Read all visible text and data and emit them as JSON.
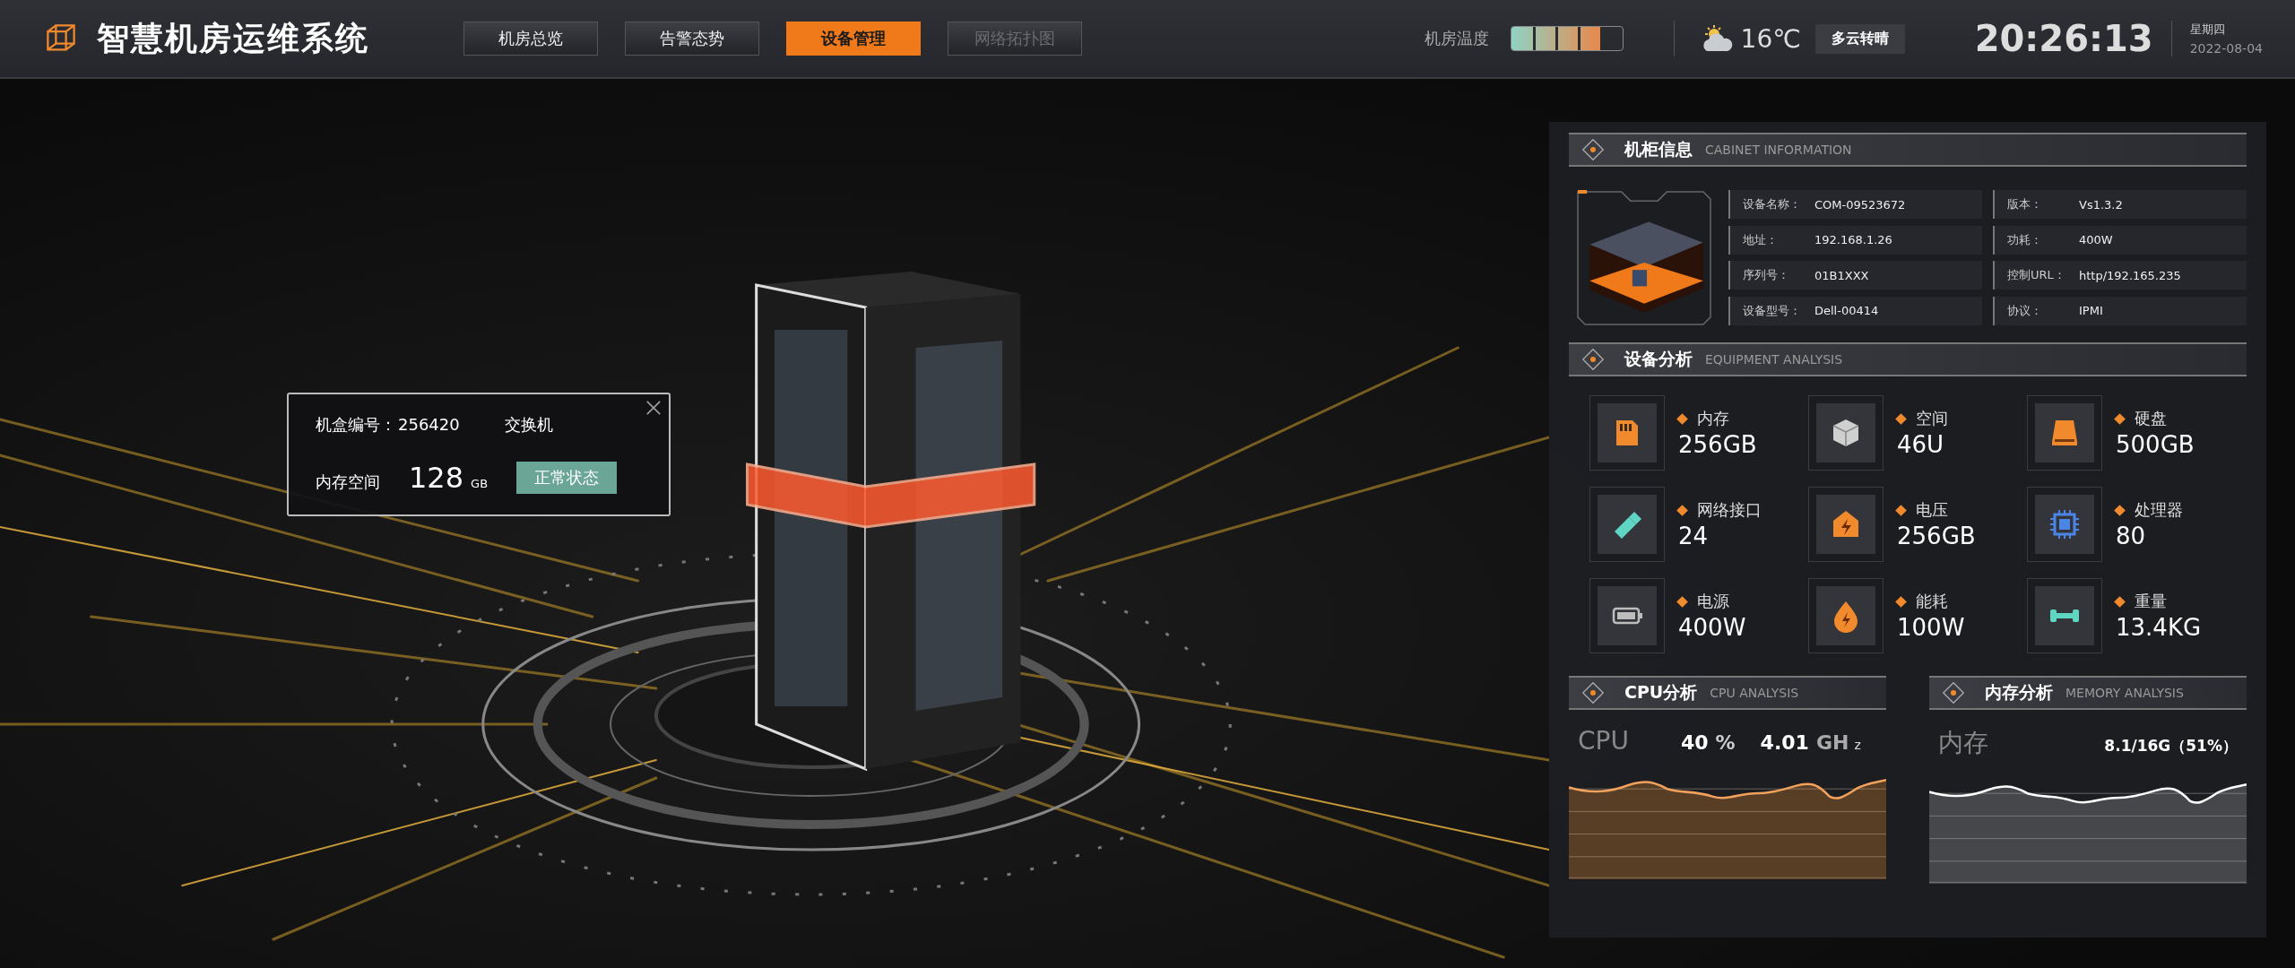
{
  "header": {
    "title": "智慧机房运维系统",
    "tabs": [
      {
        "label": "机房总览",
        "selected": false,
        "disabled": false
      },
      {
        "label": "告警态势",
        "selected": false,
        "disabled": false
      },
      {
        "label": "设备管理",
        "selected": true,
        "disabled": false
      },
      {
        "label": "网络拓扑图",
        "selected": false,
        "disabled": true
      }
    ],
    "temperature": {
      "label": "机房温度",
      "level": 0.8
    },
    "weather": {
      "temp": "16℃",
      "condition": "多云转晴"
    },
    "time": "20:26:13",
    "weekday": "星期四",
    "date": "2022-08-04"
  },
  "popup": {
    "box_label": "机盒编号：",
    "box_number": "256420",
    "device_type": "交换机",
    "memory_label": "内存空间",
    "memory_value": "128",
    "memory_unit": "GB",
    "status": "正常状态"
  },
  "cabinet_info": {
    "title": "机柜信息",
    "subtitle": "CABINET INFORMATION",
    "fields": [
      {
        "label": "设备名称：",
        "value": "COM-09523672"
      },
      {
        "label": "版本：",
        "value": "Vs1.3.2"
      },
      {
        "label": "地址：",
        "value": "192.168.1.26"
      },
      {
        "label": "功耗：",
        "value": "400W"
      },
      {
        "label": "序列号：",
        "value": "01B1XXX"
      },
      {
        "label": "控制URL：",
        "value": "http/192.165.235"
      },
      {
        "label": "设备型号：",
        "value": "Dell-00414"
      },
      {
        "label": "协议：",
        "value": "IPMI"
      }
    ]
  },
  "equipment_analysis": {
    "title": "设备分析",
    "subtitle": "EQUIPMENT ANALYSIS",
    "items": [
      {
        "kind": "memory",
        "label": "内存",
        "value": "256GB"
      },
      {
        "kind": "space",
        "label": "空间",
        "value": "46U"
      },
      {
        "kind": "disk",
        "label": "硬盘",
        "value": "500GB"
      },
      {
        "kind": "network",
        "label": "网络接口",
        "value": "24"
      },
      {
        "kind": "voltage",
        "label": "电压",
        "value": "256GB"
      },
      {
        "kind": "cpu",
        "label": "处理器",
        "value": "80"
      },
      {
        "kind": "power",
        "label": "电源",
        "value": "400W"
      },
      {
        "kind": "energy",
        "label": "能耗",
        "value": "100W"
      },
      {
        "kind": "weight",
        "label": "重量",
        "value": "13.4KG"
      }
    ]
  },
  "cpu_analysis": {
    "title": "CPU分析",
    "subtitle": "CPU ANALYSIS",
    "label": "CPU",
    "percent": "40",
    "percent_unit": "%",
    "frequency": "4.01",
    "frequency_unit": "GH",
    "frequency_suffix": "z"
  },
  "memory_analysis": {
    "title": "内存分析",
    "subtitle": "MEMORY ANALYSIS",
    "label": "内存",
    "reading": "8.1/16G（51%）"
  }
}
